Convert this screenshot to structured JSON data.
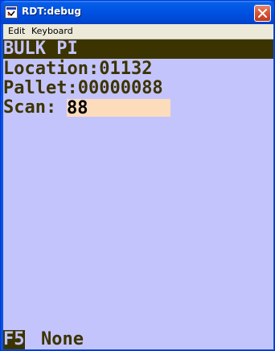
{
  "window": {
    "title": "RDT:debug"
  },
  "menu": {
    "items": [
      "Edit",
      "Keyboard"
    ]
  },
  "screen": {
    "header": "BULK PI",
    "location_label": "Location:",
    "location_value": "01132",
    "pallet_label": "Pallet:",
    "pallet_value": "00000088",
    "scan_label": "Scan:",
    "scan_value": "88"
  },
  "footer": {
    "function_key": "F5",
    "function_label": "None"
  },
  "colors": {
    "background": "#c4c4fc",
    "text": "#3c3400",
    "input_background": "#fddcbc",
    "titlebar": "#0055e5"
  },
  "icons": {
    "app": "app-window-icon",
    "close": "close-icon"
  }
}
